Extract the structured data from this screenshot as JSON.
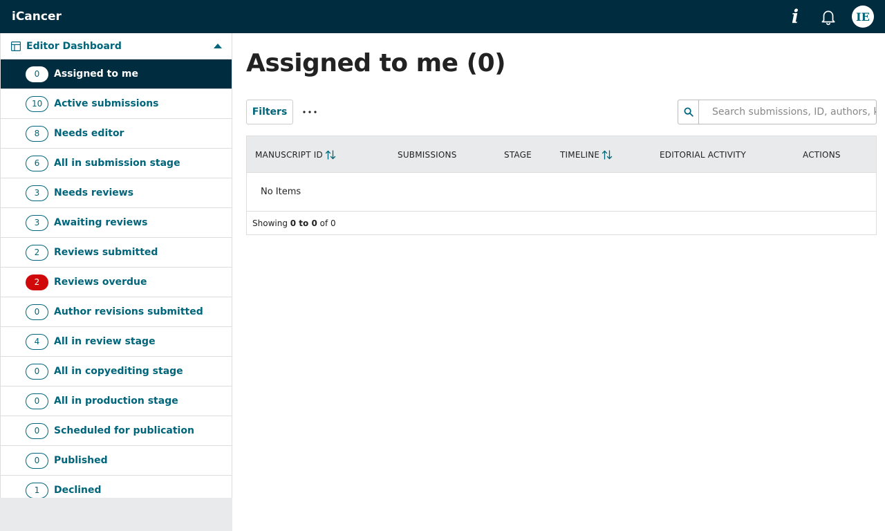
{
  "header": {
    "brand": "iCancer",
    "info_icon": "i",
    "avatar_initials": "IE"
  },
  "sidebar": {
    "title": "Editor Dashboard",
    "items": [
      {
        "count": "0",
        "label": "Assigned to me",
        "state": "active"
      },
      {
        "count": "10",
        "label": "Active submissions",
        "state": ""
      },
      {
        "count": "8",
        "label": "Needs editor",
        "state": ""
      },
      {
        "count": "6",
        "label": "All in submission stage",
        "state": ""
      },
      {
        "count": "3",
        "label": "Needs reviews",
        "state": ""
      },
      {
        "count": "3",
        "label": "Awaiting reviews",
        "state": ""
      },
      {
        "count": "2",
        "label": "Reviews submitted",
        "state": ""
      },
      {
        "count": "2",
        "label": "Reviews overdue",
        "state": "danger"
      },
      {
        "count": "0",
        "label": "Author revisions submitted",
        "state": ""
      },
      {
        "count": "4",
        "label": "All in review stage",
        "state": ""
      },
      {
        "count": "0",
        "label": "All in copyediting stage",
        "state": ""
      },
      {
        "count": "0",
        "label": "All in production stage",
        "state": ""
      },
      {
        "count": "0",
        "label": "Scheduled for publication",
        "state": ""
      },
      {
        "count": "0",
        "label": "Published",
        "state": ""
      },
      {
        "count": "1",
        "label": "Declined",
        "state": ""
      }
    ]
  },
  "main": {
    "title": "Assigned to me (0)",
    "filters_label": "Filters",
    "search_placeholder": "Search submissions, ID, authors, keywords",
    "columns": {
      "manuscript_id": "MANUSCRIPT ID",
      "submissions": "SUBMISSIONS",
      "stage": "STAGE",
      "timeline": "TIMELINE",
      "editorial_activity": "EDITORIAL ACTIVITY",
      "actions": "ACTIONS"
    },
    "empty_text": "No Items",
    "footer": {
      "prefix": "Showing",
      "range": "0 to 0",
      "suffix": "of 0"
    }
  },
  "colors": {
    "topbar": "#002c40",
    "accent": "#00657b",
    "danger": "#d00a0a"
  }
}
